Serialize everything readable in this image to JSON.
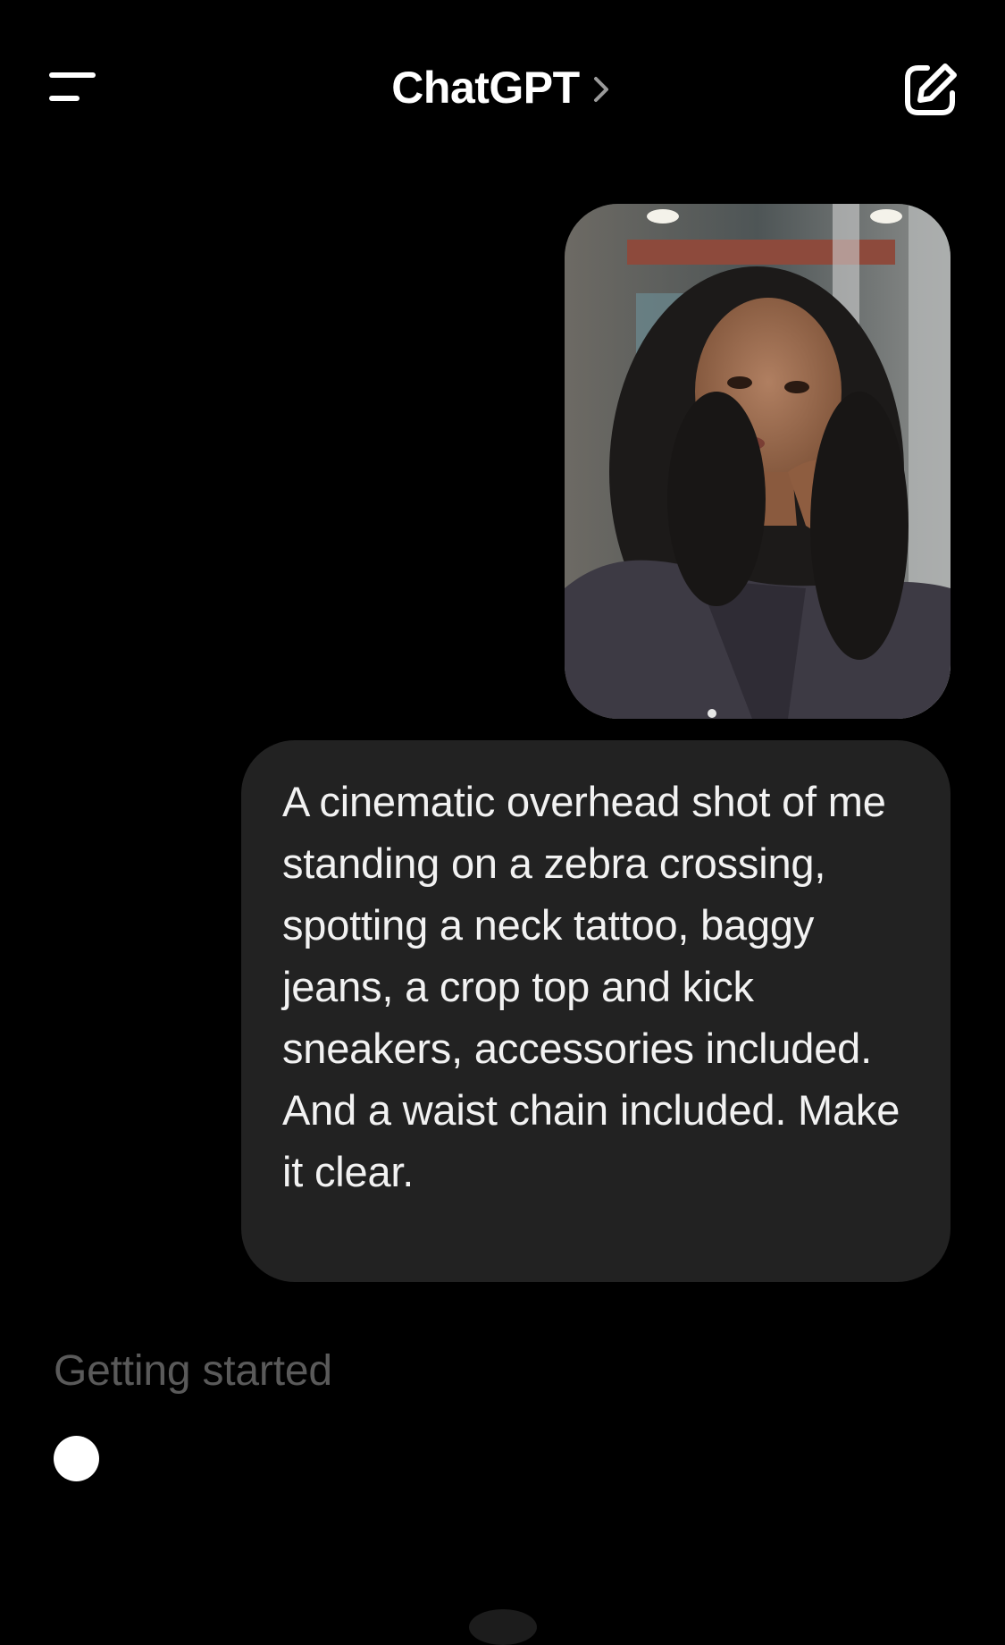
{
  "header": {
    "title": "ChatGPT",
    "menu_icon": "menu-icon",
    "title_chevron_icon": "chevron-right-icon",
    "new_chat_icon": "compose-icon"
  },
  "conversation": {
    "user_photo": {
      "description_icon": "photo-attachment"
    },
    "user_message": {
      "text": "A cinematic overhead shot of me standing on a zebra crossing, spotting a neck tattoo, baggy jeans, a crop top and kick sneakers, accessories included. And a waist chain included. Make it clear."
    },
    "assistant": {
      "status": "Getting started"
    }
  },
  "colors": {
    "background": "#000000",
    "bubble": "#222222",
    "text": "#ffffff",
    "status_text": "#5a5a5a"
  }
}
